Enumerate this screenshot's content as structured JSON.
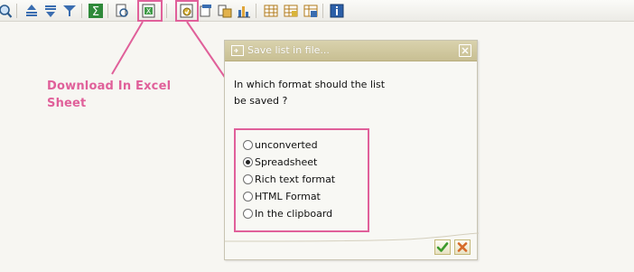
{
  "annotation": {
    "download_label_line1": "Download In Excel",
    "download_label_line2": "Sheet",
    "highlight_color": "#e0609a"
  },
  "toolbar": {
    "icons": [
      "zoom-icon",
      "sort-ascending-icon",
      "sort-descending-icon",
      "filter-icon",
      "sum-icon",
      "print-preview-icon",
      "excel-export-icon",
      "save-to-file-icon",
      "send-mail-icon",
      "abc-analysis-icon",
      "graphic-icon",
      "change-layout-icon",
      "select-layout-icon",
      "save-layout-icon",
      "info-icon"
    ]
  },
  "dialog": {
    "title": "Save list in file...",
    "question_line1": "In which format should the list",
    "question_line2": "be saved ?",
    "options": [
      {
        "label": "unconverted",
        "checked": false
      },
      {
        "label": "Spreadsheet",
        "checked": true
      },
      {
        "label": "Rich text format",
        "checked": false
      },
      {
        "label": "HTML Format",
        "checked": false
      },
      {
        "label": "In the clipboard",
        "checked": false
      }
    ],
    "titlebar_color": "#cdc59b"
  }
}
